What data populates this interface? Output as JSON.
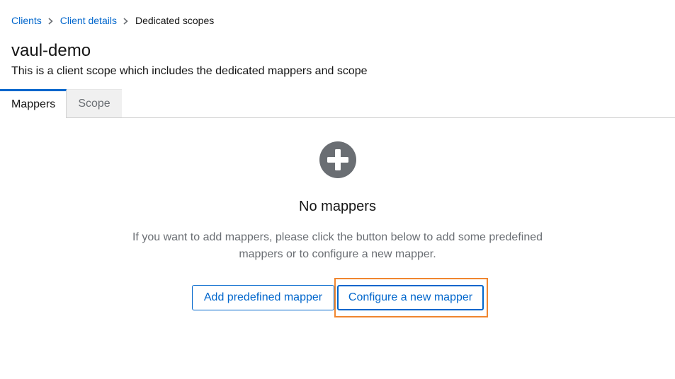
{
  "breadcrumb": {
    "items": [
      "Clients",
      "Client details"
    ],
    "current": "Dedicated scopes"
  },
  "header": {
    "title": "vaul-demo",
    "description": "This is a client scope which includes the dedicated mappers and scope"
  },
  "tabs": [
    {
      "label": "Mappers",
      "active": true
    },
    {
      "label": "Scope",
      "active": false
    }
  ],
  "empty_state": {
    "icon": "plus-circle-icon",
    "title": "No mappers",
    "body": "If you want to add mappers, please click the button below to add some predefined mappers or to configure a new mapper.",
    "add_predefined_label": "Add predefined mapper",
    "configure_new_label": "Configure a new mapper"
  },
  "colors": {
    "link": "#0066cc",
    "highlight": "#f0862f",
    "icon": "#6a6e73"
  }
}
